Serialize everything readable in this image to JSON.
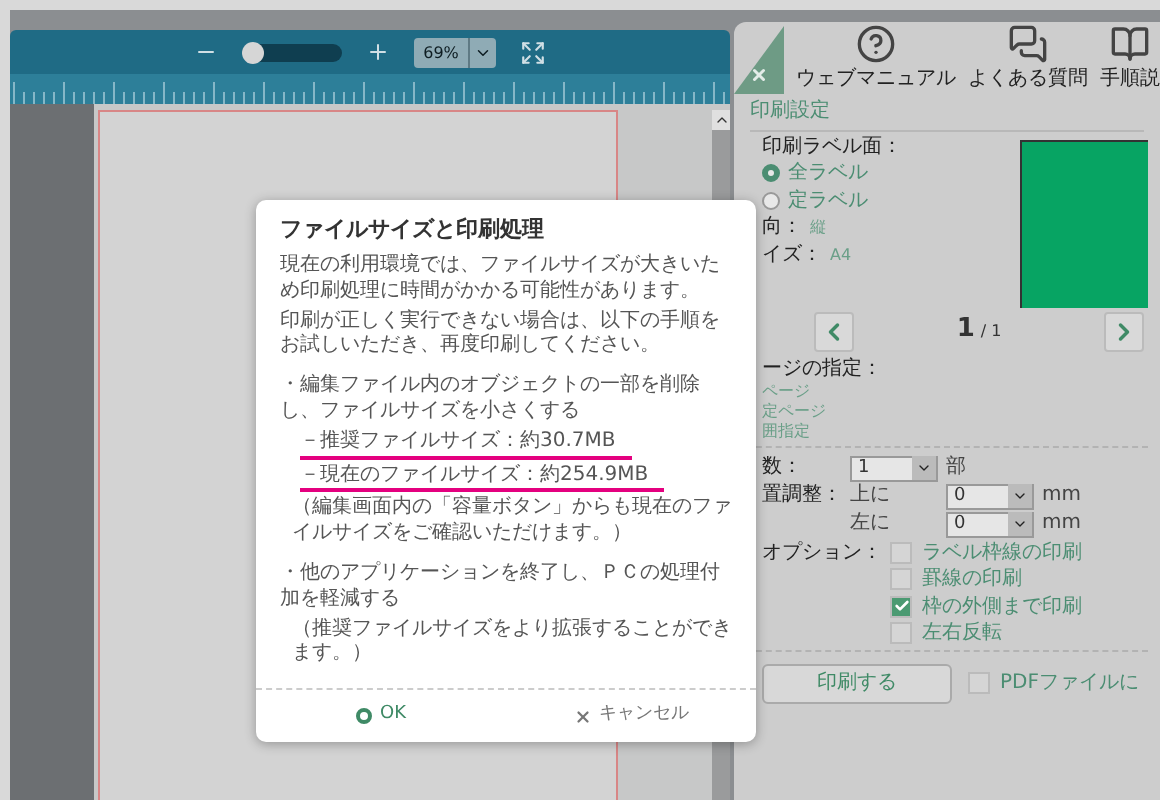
{
  "toolbar": {
    "zoom_slider": {
      "level": 0.1
    },
    "zoom_select": {
      "value": "69%"
    }
  },
  "panel": {
    "help_items": [
      {
        "kind": "manual",
        "label": "ウェブマニュアル"
      },
      {
        "kind": "faq",
        "label": "よくある質問"
      },
      {
        "kind": "guide",
        "label": "手順説"
      }
    ],
    "section_title": "印刷設定",
    "label_side": {
      "heading": "印刷ラベル面：",
      "options": [
        {
          "label": "全ラベル",
          "selected": true
        },
        {
          "label": "定ラベル",
          "selected": false
        }
      ]
    },
    "orientation": {
      "label": "向：",
      "value": "縦"
    },
    "size": {
      "label": "イズ：",
      "value": "A4"
    },
    "pager": {
      "current": "1",
      "total": "/ 1"
    },
    "page_spec": {
      "heading": "ージの指定：",
      "options": [
        "ページ",
        "定ページ",
        "囲指定"
      ]
    },
    "copies": {
      "label": "数：",
      "value": "1",
      "unit": "部"
    },
    "position": {
      "label": "置調整：",
      "rows": [
        {
          "label": "上に",
          "value": "0",
          "unit": "mm"
        },
        {
          "label": "左に",
          "value": "0",
          "unit": "mm"
        }
      ]
    },
    "options": {
      "label": "オプション：",
      "items": [
        {
          "label": "ラベル枠線の印刷",
          "checked": false
        },
        {
          "label": "罫線の印刷",
          "checked": false
        },
        {
          "label": "枠の外側まで印刷",
          "checked": true
        },
        {
          "label": "左右反転",
          "checked": false
        }
      ]
    },
    "print_button": "印刷する",
    "pdf_option": {
      "label": "PDFファイルに",
      "checked": false
    }
  },
  "dialog": {
    "title": "ファイルサイズと印刷処理",
    "paragraphs": [
      "現在の利用環境では、ファイルサイズが大きいため印刷処理に時間がかかる可能性があります。",
      "印刷が正しく実行できない場合は、以下の手順をお試しいただき、再度印刷してください。"
    ],
    "steps": [
      {
        "text": "・編集ファイル内のオブジェクトの一部を削除し、ファイルサイズを小さくする",
        "details": [
          {
            "text": "－推奨ファイルサイズ：約30.7MB",
            "underlined": true
          },
          {
            "text": "－現在のファイルサイズ：約254.9MB",
            "underlined": true
          },
          {
            "text": "（編集画面内の「容量ボタン」からも現在のファイルサイズをご確認いただけます。）",
            "underlined": false
          }
        ]
      },
      {
        "text": "・他のアプリケーションを終了し、ＰＣの処理付加を軽減する",
        "details": [
          {
            "text": "（推奨ファイルサイズをより拡張することができます。）",
            "underlined": false
          }
        ]
      }
    ],
    "buttons": [
      {
        "kind": "ok",
        "label": "OK"
      },
      {
        "kind": "cancel",
        "label": "キャンセル"
      }
    ]
  }
}
